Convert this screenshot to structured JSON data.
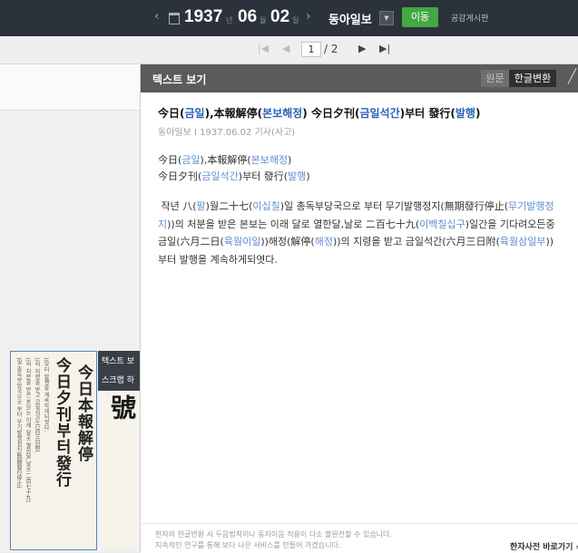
{
  "topbar": {
    "year": "1937",
    "year_unit": "년",
    "month": "06",
    "month_unit": "월",
    "day": "02",
    "day_unit": "일",
    "paper_name": "동아일보",
    "go_label": "이동",
    "board_label": "공감게시판"
  },
  "pager": {
    "current_page": "1",
    "total": "/ 2"
  },
  "left": {
    "thumb_headline_1": "今日本報解停",
    "thumb_headline_2": "今日夕刊부터發行",
    "thumb_menu_1": "텍스트 보",
    "thumb_menu_2": "스크랩 하",
    "thumb2_text": "東亞日報外號"
  },
  "panel": {
    "title": "텍스트 보기",
    "tab_original": "원문",
    "tab_hangul": "한글변환",
    "article_title": {
      "p1": "今日(",
      "h1": "금일",
      "p2": "),本報解停(",
      "h2": "본보해정",
      "p3": ") 今日夕刊(",
      "h3": "금일석간",
      "p4": ")부터 發行(",
      "h4": "발행",
      "p5": ")"
    },
    "meta": {
      "source": "동아일보",
      "date": "1937.06.02",
      "type": "기사(사고)"
    },
    "line1": {
      "a": "今日(",
      "b": "금일",
      "c": "),本報解停(",
      "d": "본보해정",
      "e": ")"
    },
    "line2": {
      "a": "今日夕刊(",
      "b": "금일석간",
      "c": ")부터 發行(",
      "d": "발행",
      "e": ")"
    },
    "body": {
      "s1": "작년 八(",
      "h1": "팔",
      "s2": ")월二十七(",
      "h2": "이십칠",
      "s3": ")일 총독부당국으로 부터 무기발행정지(無期發行停止(",
      "h3": "무기발행정지",
      "s4": "))의 처분을 받은 본보는 이래 달로 열한달,날로 二百七十九(",
      "h4": "이백칠십구",
      "s5": ")일간을 기다려오든중 금일(六月二日(",
      "h5": "육월이일",
      "s6": "))해정(解停(",
      "h6": "해정",
      "s7": "))의 지령을 받고 금일석간(六月三日附(",
      "h7": "육월삼일부",
      "s8": "))부터 발행을 계속하게되엿다."
    },
    "notice_1": "한자의 한글변환 시 두음법칙이나 동자이음 적용이 다소 불완전할 수 있습니다.",
    "notice_2": "지속적인 연구를 통해 보다 나은 서비스를 만들어 가겠습니다.",
    "dict_link": "한자사전 바로가기 ›"
  },
  "colors": {
    "topbar": "#2c323b",
    "go_button": "#43a844",
    "hanja_highlight": "#2a63b8",
    "panel_header": "#5b5b5b"
  }
}
